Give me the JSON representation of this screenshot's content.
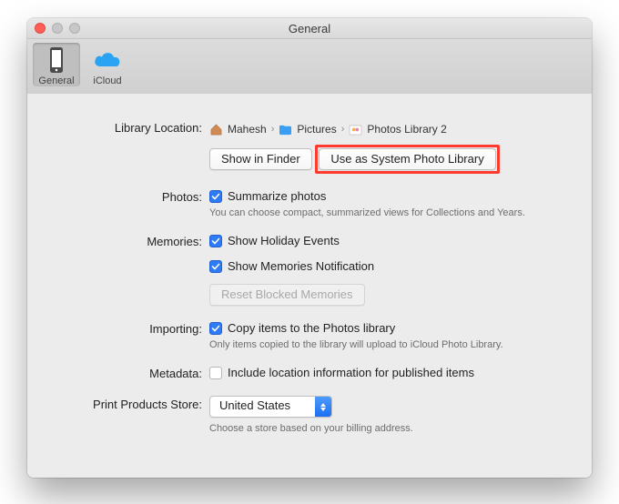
{
  "window": {
    "title": "General"
  },
  "tabs": {
    "general": "General",
    "icloud": "iCloud"
  },
  "library": {
    "label": "Library Location:",
    "crumb": {
      "home": "Mahesh",
      "folder": "Pictures",
      "library": "Photos Library 2"
    },
    "show_btn": "Show in Finder",
    "use_btn": "Use as System Photo Library"
  },
  "photos": {
    "label": "Photos:",
    "summarize": "Summarize photos",
    "hint": "You can choose compact, summarized views for Collections and Years."
  },
  "memories": {
    "label": "Memories:",
    "holiday": "Show Holiday Events",
    "notif": "Show Memories Notification",
    "reset_btn": "Reset Blocked Memories"
  },
  "importing": {
    "label": "Importing:",
    "copy": "Copy items to the Photos library",
    "hint": "Only items copied to the library will upload to iCloud Photo Library."
  },
  "metadata": {
    "label": "Metadata:",
    "include": "Include location information for published items"
  },
  "store": {
    "label": "Print Products Store:",
    "value": "United States",
    "hint": "Choose a store based on your billing address."
  }
}
